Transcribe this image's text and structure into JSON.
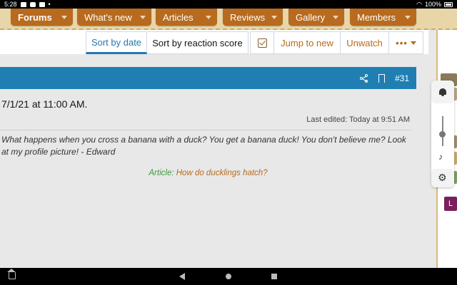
{
  "status_bar": {
    "time": "5:28",
    "battery": "100%"
  },
  "nav": {
    "items": [
      {
        "label": "Forums",
        "active": true
      },
      {
        "label": "What's new",
        "active": false
      },
      {
        "label": "Articles",
        "active": false
      },
      {
        "label": "Reviews",
        "active": false
      },
      {
        "label": "Gallery",
        "active": false
      },
      {
        "label": "Members",
        "active": false
      }
    ]
  },
  "toolbar": {
    "sort_by_date": "Sort by date",
    "sort_by_reaction": "Sort by reaction score",
    "jump_to_new": "Jump to new",
    "unwatch": "Unwatch",
    "more": "•••"
  },
  "post": {
    "number": "#31",
    "timestamp": "7/1/21 at 11:00 AM.",
    "last_edited": "Last edited: Today at 9:51 AM",
    "signature": "What happens when you cross a banana with a duck? You get a banana duck! You don't believe me? Look at my profile picture! - Edward",
    "article_prefix": "Article:",
    "article_title": "How do ducklings hatch?"
  },
  "side_badge": "L",
  "colors": {
    "nav_tab": "#b86a1e",
    "post_header": "#1f7fb3",
    "accent": "#2577b1",
    "link": "#b86a1e"
  },
  "icons": [
    "share-icon",
    "bookmark-icon",
    "bell-icon",
    "music-note-icon",
    "gear-icon",
    "checkbox-icon",
    "chevron-down-icon"
  ]
}
